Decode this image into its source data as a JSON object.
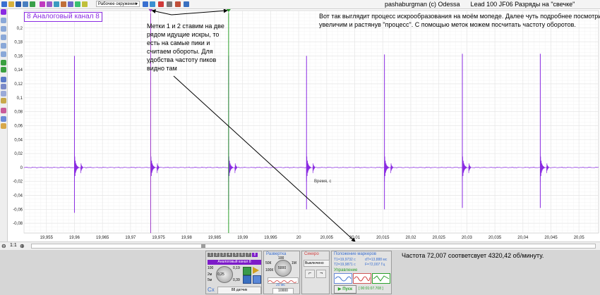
{
  "window": {
    "title": "pashaburgman (c) Odessa      Lead 100 JF06 Разряды на \"свечке\""
  },
  "toolbar": {
    "workspace_label": "Рабочее окружение"
  },
  "channel": {
    "name": "8 Аналоговый канал 8"
  },
  "annotations": {
    "left_note": "Метки 1 и 2 ставим на две\nрядом идущие искры, то\nесть на самые пики и\nсчитаем обороты. Для\nудобства частоту пиков\nвидно там",
    "right_note": "Вот так выглядит процесс искрообразования на моём мопеде. Далее чуть подробнее посмотрим,\nувеличим и растянув \"процесс\". С помощью меток можем посчитать частоту оборотов.",
    "bottom_note": "Частота 72,007 соответсвует 4320,42 об/минуту."
  },
  "colors": {
    "signal": "#8a2be2",
    "marker1": "#a040c8",
    "marker2": "#2aa02a",
    "grid": "#e6e6e6",
    "arrow": "#000000"
  },
  "chart_data": {
    "type": "line",
    "x_axis_label": "Время, с",
    "xlim": [
      19.951,
      20.0535
    ],
    "ylim": [
      -0.094,
      0.225
    ],
    "x_ticks": [
      "19,955",
      "19,96",
      "19,965",
      "19,97",
      "19,975",
      "19,98",
      "19,985",
      "19,99",
      "19,995",
      "20",
      "20,005",
      "20,01",
      "20,015",
      "20,02",
      "20,025",
      "20,03",
      "20,035",
      "20,04",
      "20,045",
      "20,05"
    ],
    "x_tick_values": [
      19.955,
      19.96,
      19.965,
      19.97,
      19.975,
      19.98,
      19.985,
      19.99,
      19.995,
      20.0,
      20.005,
      20.01,
      20.015,
      20.02,
      20.025,
      20.03,
      20.035,
      20.04,
      20.045,
      20.05
    ],
    "y_ticks": [
      "0,2",
      "0,18",
      "0,16",
      "0,14",
      "0,12",
      "0,1",
      "0,08",
      "0,06",
      "0,04",
      "0,02",
      "0",
      "-0,02",
      "-0,04",
      "-0,06",
      "-0,08"
    ],
    "y_tick_values": [
      0.2,
      0.18,
      0.16,
      0.14,
      0.12,
      0.1,
      0.08,
      0.06,
      0.04,
      0.02,
      0,
      -0.02,
      -0.04,
      -0.06,
      -0.08
    ],
    "peaks_x": [
      19.96,
      19.9736,
      19.9875,
      20.0014,
      20.0153,
      20.0292,
      20.0431
    ],
    "peaks_top": [
      0.16,
      0.165,
      0.16,
      0.16,
      0.162,
      0.163,
      0.163
    ],
    "peaks_bottom": [
      -0.065,
      -0.058,
      -0.06,
      -0.06,
      -0.06,
      -0.058,
      -0.058
    ],
    "marker1_x": 19.9736,
    "marker2_x": 19.9875,
    "marker_labels": [
      "1",
      "2"
    ]
  },
  "panels": {
    "sweep_title": "Развертка",
    "sweep_value": "20 мс",
    "sweep_points": "10000",
    "sweep_knob_labels": [
      "100",
      "1М",
      "50К",
      "100К",
      "5000"
    ],
    "channel_panel_title": "Аналоговый канал 8",
    "channel_knob_labels": [
      "100",
      "0,19",
      "2м",
      "0,25",
      "5м",
      "0,39"
    ],
    "sensors_label": "88 датчик",
    "cx_label": "Cx",
    "sync_title": "Синхро",
    "sync_value": "Выключено",
    "markers_title": "Положение маркеров",
    "markers_t1": "T1=19,9732 с",
    "markers_t2": "T2=19,9871 с",
    "markers_dt": "dT=13,888 мс",
    "markers_f": "F=72,007 Гц",
    "control_title": "Управление",
    "start_button": "Пуск",
    "time_readout": "[ 00:01:07.708 ]",
    "digits": [
      "1",
      "2",
      "3",
      "4",
      "5",
      "6",
      "7",
      "8"
    ]
  },
  "status": {
    "zoom_buttons": [
      "⊖",
      "1:1",
      "⊕"
    ]
  }
}
